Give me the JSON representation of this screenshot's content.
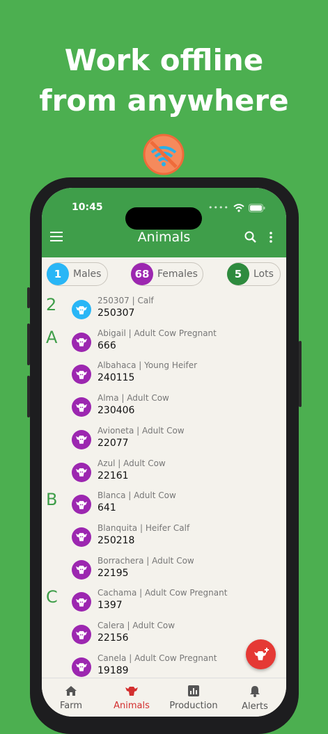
{
  "headline": {
    "line1": "Work offline",
    "line2": "from anywhere"
  },
  "status_bar": {
    "time": "10:45"
  },
  "app_bar": {
    "title": "Animals"
  },
  "chips": [
    {
      "count": "1",
      "label": "Males",
      "color": "#29b6f6"
    },
    {
      "count": "68",
      "label": "Females",
      "color": "#9c27b0"
    },
    {
      "count": "5",
      "label": "Lots",
      "color": "#2e8b3e"
    }
  ],
  "animals": [
    {
      "letter": "2",
      "subtitle": "250307 | Calf",
      "tag": "250307",
      "color": "#29b6f6",
      "icon": "cow-icon"
    },
    {
      "letter": "A",
      "subtitle": "Abigail | Adult Cow Pregnant",
      "tag": "666",
      "color": "#9c27b0",
      "icon": "cow-icon"
    },
    {
      "letter": "",
      "subtitle": "Albahaca | Young Heifer",
      "tag": "240115",
      "color": "#9c27b0",
      "icon": "cow-icon"
    },
    {
      "letter": "",
      "subtitle": "Alma | Adult Cow",
      "tag": "230406",
      "color": "#9c27b0",
      "icon": "cow-icon"
    },
    {
      "letter": "",
      "subtitle": "Avioneta | Adult Cow",
      "tag": "22077",
      "color": "#9c27b0",
      "icon": "cow-icon"
    },
    {
      "letter": "",
      "subtitle": "Azul | Adult Cow",
      "tag": "22161",
      "color": "#9c27b0",
      "icon": "cow-icon"
    },
    {
      "letter": "B",
      "subtitle": "Blanca | Adult Cow",
      "tag": "641",
      "color": "#9c27b0",
      "icon": "cow-icon"
    },
    {
      "letter": "",
      "subtitle": "Blanquita | Heifer Calf",
      "tag": "250218",
      "color": "#9c27b0",
      "icon": "cow-icon"
    },
    {
      "letter": "",
      "subtitle": "Borrachera | Adult Cow",
      "tag": "22195",
      "color": "#9c27b0",
      "icon": "cow-icon"
    },
    {
      "letter": "C",
      "subtitle": "Cachama | Adult Cow Pregnant",
      "tag": "1397",
      "color": "#9c27b0",
      "icon": "cow-icon"
    },
    {
      "letter": "",
      "subtitle": "Calera | Adult Cow",
      "tag": "22156",
      "color": "#9c27b0",
      "icon": "cow-icon"
    },
    {
      "letter": "",
      "subtitle": "Canela | Adult Cow Pregnant",
      "tag": "19189",
      "color": "#9c27b0",
      "icon": "cow-icon"
    }
  ],
  "bottom_nav": [
    {
      "label": "Farm",
      "icon": "home-icon",
      "active": false
    },
    {
      "label": "Animals",
      "icon": "cow-icon",
      "active": true
    },
    {
      "label": "Production",
      "icon": "bar-chart-icon",
      "active": false
    },
    {
      "label": "Alerts",
      "icon": "bell-icon",
      "active": false
    }
  ],
  "colors": {
    "background": "#4caf50",
    "appbar": "#3f9e4a",
    "fab": "#e53935",
    "active_nav": "#d32f2f"
  }
}
